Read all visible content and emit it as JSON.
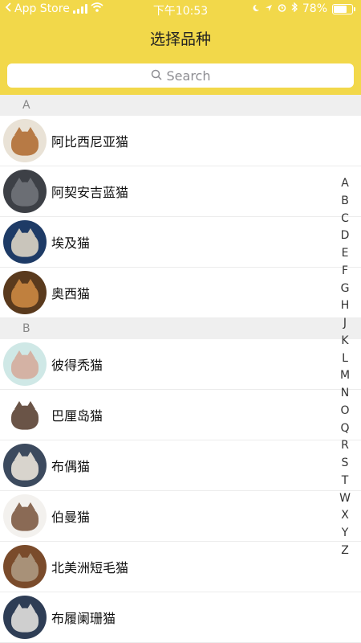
{
  "status_bar": {
    "back_app": "App Store",
    "time": "下午10:53",
    "battery": "78%",
    "battery_level": 0.78
  },
  "header": {
    "title": "选择品种",
    "search_placeholder": "Search"
  },
  "sections": [
    {
      "letter": "A",
      "items": [
        {
          "name": "阿比西尼亚猫",
          "colors": [
            "#e9e2d6",
            "#b77a45"
          ]
        },
        {
          "name": "阿契安吉蓝猫",
          "colors": [
            "#3d4046",
            "#6b6e74"
          ]
        },
        {
          "name": "埃及猫",
          "colors": [
            "#1e3b66",
            "#c9c5bb"
          ]
        },
        {
          "name": "奥西猫",
          "colors": [
            "#5a3a1d",
            "#c0803e"
          ]
        }
      ]
    },
    {
      "letter": "B",
      "items": [
        {
          "name": "彼得秃猫",
          "colors": [
            "#cfe8e6",
            "#d4b2a4"
          ]
        },
        {
          "name": "巴厘岛猫",
          "colors": [
            "#ffffff",
            "#6a5447"
          ]
        },
        {
          "name": "布偶猫",
          "colors": [
            "#3c4a5e",
            "#d8d4cd"
          ]
        },
        {
          "name": "伯曼猫",
          "colors": [
            "#f3f1ee",
            "#8a6a55"
          ]
        },
        {
          "name": "北美洲短毛猫",
          "colors": [
            "#7a4b2b",
            "#a89178"
          ]
        },
        {
          "name": "布履阑珊猫",
          "colors": [
            "#2e3d55",
            "#cfcfcf"
          ]
        }
      ]
    }
  ],
  "index_letters": [
    "A",
    "B",
    "C",
    "D",
    "E",
    "F",
    "G",
    "H",
    "J",
    "K",
    "L",
    "M",
    "N",
    "O",
    "Q",
    "R",
    "S",
    "T",
    "W",
    "X",
    "Y",
    "Z"
  ]
}
